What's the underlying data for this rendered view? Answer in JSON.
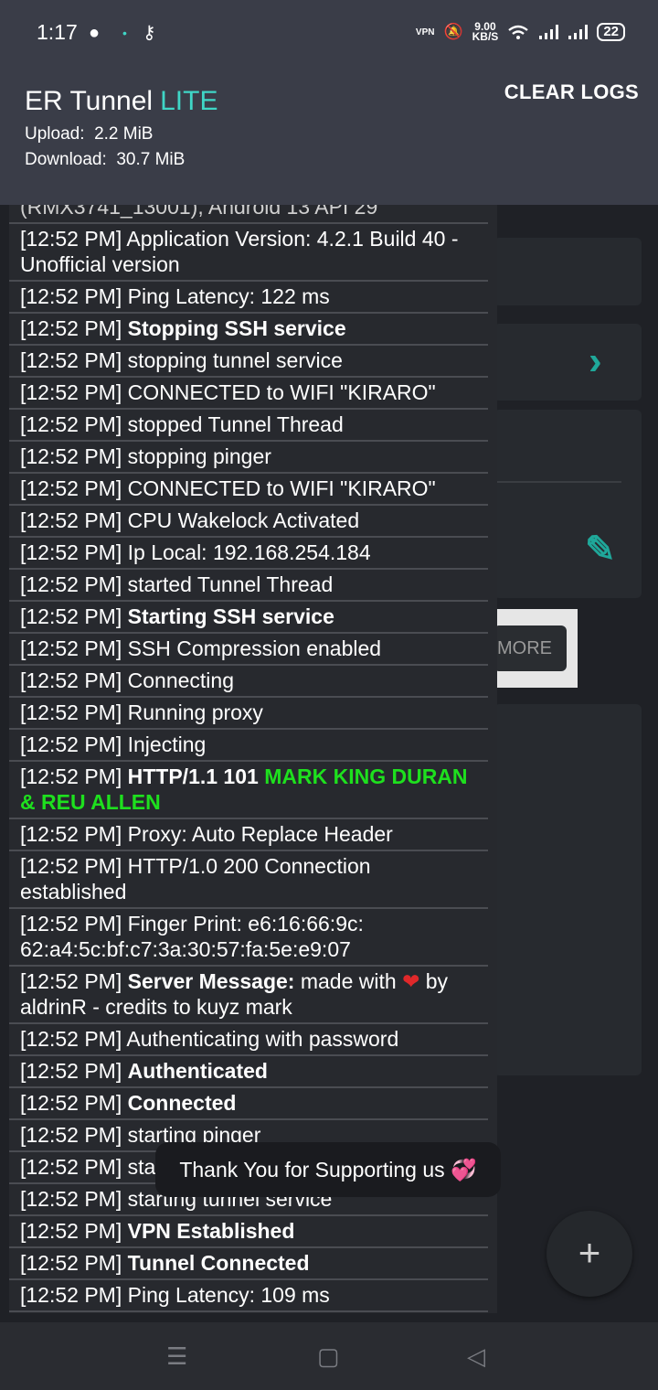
{
  "status_bar": {
    "time": "1:17",
    "speed_value": "9.00",
    "speed_unit": "KB/S",
    "vpn": "VPN",
    "battery": "22"
  },
  "header": {
    "app_name": "ER Tunnel",
    "badge": "LITE",
    "upload_label": "Upload:",
    "upload_value": "2.2 MiB",
    "download_label": "Download:",
    "download_value": "30.7 MiB",
    "clear_logs": "CLEAR LOGS"
  },
  "background": {
    "more_button": "MORE"
  },
  "log": {
    "cut_top": "(RMX3741_13001), Android 13 API 29",
    "entries": [
      {
        "time": "[12:52 PM]",
        "text": "Application Version: 4.2.1 Build 40 - Unofficial version"
      },
      {
        "time": "[12:52 PM]",
        "text": "Ping Latency: 122 ms"
      },
      {
        "time": "[12:52 PM]",
        "bold": "Stopping SSH service"
      },
      {
        "time": "[12:52 PM]",
        "text": "stopping tunnel service"
      },
      {
        "time": "[12:52 PM]",
        "text": "CONNECTED to WIFI \"KIRARO\""
      },
      {
        "time": "[12:52 PM]",
        "text": "stopped Tunnel Thread"
      },
      {
        "time": "[12:52 PM]",
        "text": "stopping pinger"
      },
      {
        "time": "[12:52 PM]",
        "text": "CONNECTED to WIFI \"KIRARO\""
      },
      {
        "time": "[12:52 PM]",
        "text": "CPU Wakelock Activated"
      },
      {
        "time": "[12:52 PM]",
        "text": "Ip Local: 192.168.254.184"
      },
      {
        "time": "[12:52 PM]",
        "text": "started Tunnel Thread"
      },
      {
        "time": "[12:52 PM]",
        "bold": "Starting SSH service"
      },
      {
        "time": "[12:52 PM]",
        "text": "SSH Compression enabled"
      },
      {
        "time": "[12:52 PM]",
        "text": "Connecting"
      },
      {
        "time": "[12:52 PM]",
        "text": "Running proxy"
      },
      {
        "time": "[12:52 PM]",
        "text": "Injecting"
      },
      {
        "time": "[12:52 PM]",
        "bold": "HTTP/1.1 101",
        "green": "MARK KING DURAN & REU ALLEN"
      },
      {
        "time": "[12:52 PM]",
        "text": "Proxy: Auto Replace Header"
      },
      {
        "time": "[12:52 PM]",
        "text": "HTTP/1.0 200 Connection established"
      },
      {
        "time": "[12:52 PM]",
        "text": "Finger Print: e6:16:66:9c: 62:a4:5c:bf:c7:3a:30:57:fa:5e:e9:07"
      },
      {
        "time": "[12:52 PM]",
        "bold": "Server Message:",
        "text": "made with",
        "heart": "❤",
        "text2": "by aldrinR - credits to kuyz mark"
      },
      {
        "time": "[12:52 PM]",
        "text": "Authenticating with password"
      },
      {
        "time": "[12:52 PM]",
        "bold": "Authenticated"
      },
      {
        "time": "[12:52 PM]",
        "bold": "Connected"
      },
      {
        "time": "[12:52 PM]",
        "text": "starting pinger"
      },
      {
        "time": "[12:52 PM]",
        "text": "started tunnel service"
      },
      {
        "time": "[12:52 PM]",
        "text": "starting tunnel service"
      },
      {
        "time": "[12:52 PM]",
        "bold": "VPN Established"
      },
      {
        "time": "[12:52 PM]",
        "bold": "Tunnel Connected"
      },
      {
        "time": "[12:52 PM]",
        "text": "Ping Latency: 109 ms"
      }
    ]
  },
  "toast": {
    "message": "Thank You for Supporting us 💞"
  },
  "fab": {
    "icon": "plus-icon",
    "glyph": "+"
  },
  "icons": {
    "messenger": "●",
    "dot": "•",
    "key": "⚷",
    "mute": "🔕",
    "chevron": "›",
    "edit": "✎",
    "nav_menu": "☰",
    "nav_home": "▢",
    "nav_back": "◁"
  },
  "colors": {
    "accent": "#3fd6c6",
    "green_text": "#1ee01e",
    "teal_icon": "#1fa89a"
  }
}
